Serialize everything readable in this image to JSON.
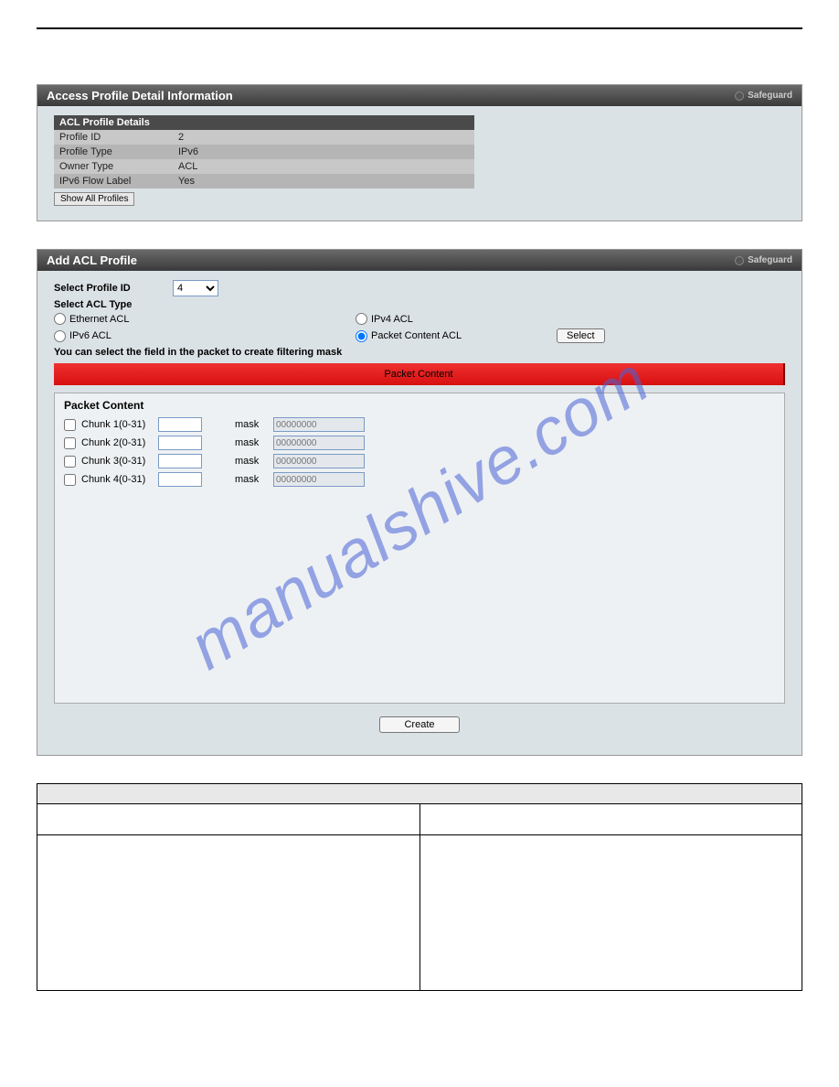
{
  "watermark": "manualshive.com",
  "panel1": {
    "title": "Access Profile Detail Information",
    "safeguard": "Safeguard",
    "table_header": "ACL Profile Details",
    "rows": [
      {
        "k": "Profile ID",
        "v": "2"
      },
      {
        "k": "Profile Type",
        "v": "IPv6"
      },
      {
        "k": "Owner Type",
        "v": "ACL"
      },
      {
        "k": "IPv6 Flow Label",
        "v": "Yes"
      }
    ],
    "show_all": "Show All Profiles"
  },
  "panel2": {
    "title": "Add ACL Profile",
    "safeguard": "Safeguard",
    "select_profile_id_label": "Select Profile ID",
    "select_profile_id_value": "4",
    "select_acl_type_label": "Select ACL Type",
    "radios": {
      "ethernet": "Ethernet ACL",
      "ipv4": "IPv4 ACL",
      "ipv6": "IPv6 ACL",
      "packet": "Packet Content ACL"
    },
    "select_btn": "Select",
    "hint": "You can select the field in the packet to create filtering mask",
    "red_band": "Packet Content",
    "pc_title": "Packet Content",
    "chunks": [
      {
        "label": "Chunk 1(0-31)",
        "mask_label": "mask",
        "mask_ph": "00000000"
      },
      {
        "label": "Chunk 2(0-31)",
        "mask_label": "mask",
        "mask_ph": "00000000"
      },
      {
        "label": "Chunk 3(0-31)",
        "mask_label": "mask",
        "mask_ph": "00000000"
      },
      {
        "label": "Chunk 4(0-31)",
        "mask_label": "mask",
        "mask_ph": "00000000"
      }
    ],
    "create_btn": "Create"
  },
  "param_table": {
    "header": " ",
    "rows": [
      {
        "k": " ",
        "v": " "
      },
      {
        "k": " ",
        "v": " "
      }
    ]
  }
}
